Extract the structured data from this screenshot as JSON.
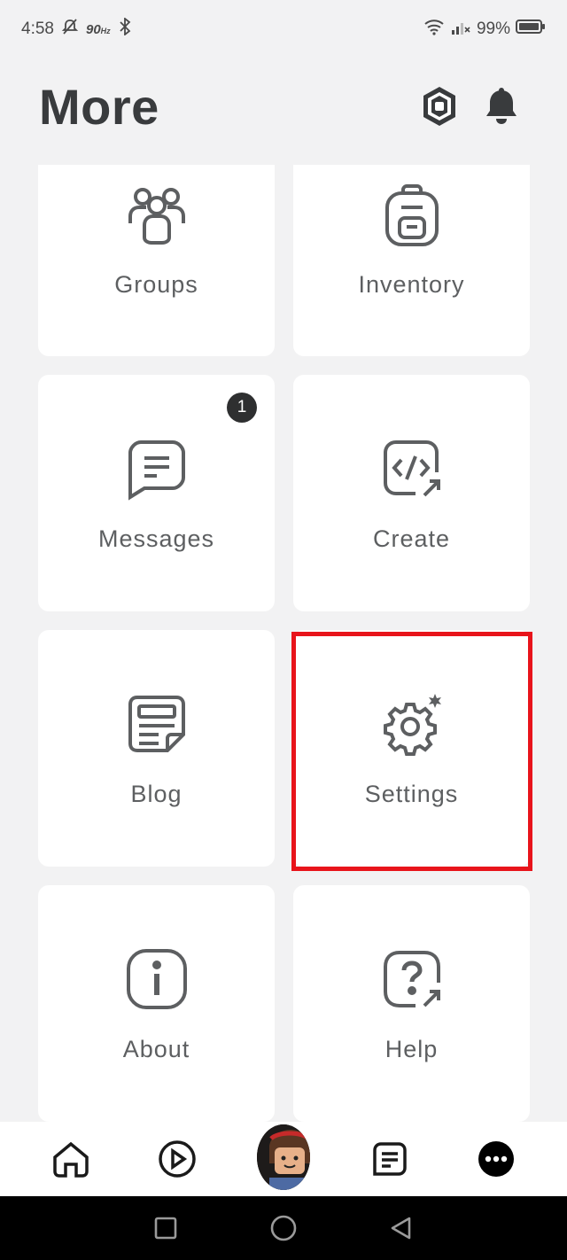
{
  "status_bar": {
    "time": "4:58",
    "refresh_rate": "90",
    "refresh_unit": "Hz",
    "battery": "99%"
  },
  "header": {
    "title": "More",
    "icons": [
      "robux-icon",
      "notification-bell-icon"
    ]
  },
  "tiles": [
    {
      "label": "Groups",
      "icon": "groups-icon"
    },
    {
      "label": "Inventory",
      "icon": "backpack-icon"
    },
    {
      "label": "Messages",
      "icon": "message-icon",
      "badge": "1"
    },
    {
      "label": "Create",
      "icon": "code-create-icon"
    },
    {
      "label": "Blog",
      "icon": "blog-icon"
    },
    {
      "label": "Settings",
      "icon": "settings-gear-icon"
    },
    {
      "label": "About",
      "icon": "info-icon"
    },
    {
      "label": "Help",
      "icon": "help-icon"
    }
  ],
  "bottom_nav": [
    "home-icon",
    "discover-play-icon",
    "avatar",
    "feed-icon",
    "more-icon"
  ],
  "system_nav": [
    "recents-icon",
    "home-circle-icon",
    "back-icon"
  ],
  "colors": {
    "background": "#f2f2f3",
    "tile": "#ffffff",
    "icon": "#5d5f61",
    "highlight": "#e8141b"
  }
}
